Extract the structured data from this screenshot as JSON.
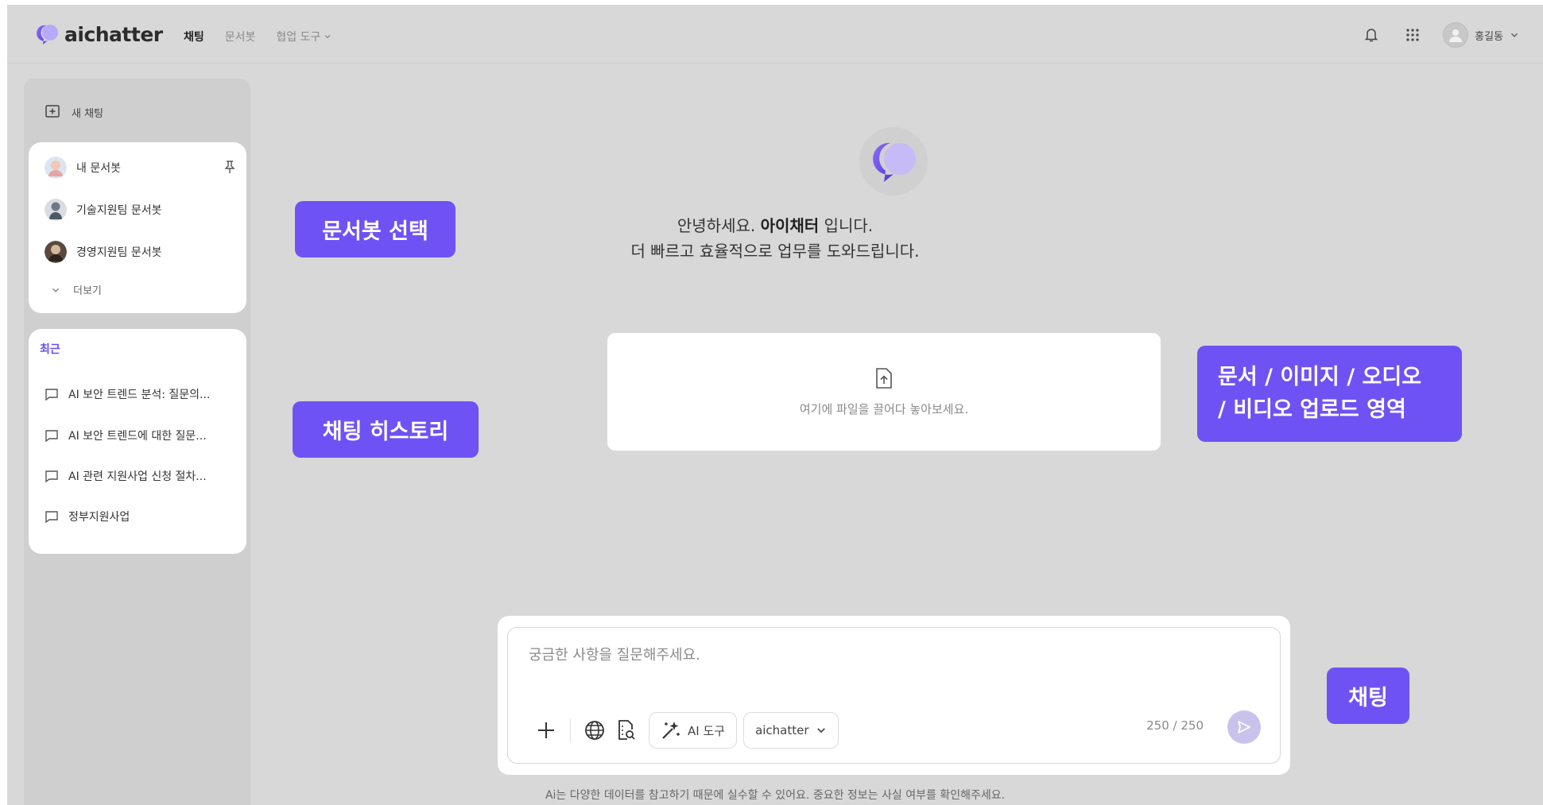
{
  "header": {
    "logo_text": "aichatter",
    "nav": {
      "chat": "채팅",
      "docbot": "문서봇",
      "collab": "협업 도구"
    },
    "user_name": "홍길동"
  },
  "sidebar": {
    "new_chat": "새 채팅",
    "bots": [
      {
        "label": "내 문서봇"
      },
      {
        "label": "기술지원팀 문서봇"
      },
      {
        "label": "경영지원팀 문서봇"
      }
    ],
    "more": "더보기",
    "recent_title": "최근",
    "recent": [
      {
        "label": "AI 보안 트렌드 분석: 질문의..."
      },
      {
        "label": "AI 보안 트렌드에 대한 질문..."
      },
      {
        "label": "AI 관련 지원사업 신청 절차..."
      },
      {
        "label": "정부지원사업"
      }
    ]
  },
  "main": {
    "greet_pre": "안녕하세요. ",
    "greet_bold": "아이채터",
    "greet_post": " 입니다.",
    "greet_line2": "더 빠르고 효율적으로 업무를 도와드립니다.",
    "drop_text": "여기에 파일을 끌어다 놓아보세요."
  },
  "chat": {
    "placeholder": "궁금한 사항을 질문해주세요.",
    "ai_tool": "AI 도구",
    "model": "aichatter",
    "count": "250 / 250",
    "disclaimer": "Ai는 다양한 데이터를 참고하기 때문에 실수할 수 있어요. 중요한 정보는 사실 여부를 확인해주세요."
  },
  "annotations": {
    "docbot_select": "문서봇 선택",
    "chat_history": "채팅 히스토리",
    "upload_line1": "문서 / 이미지 / 오디오",
    "upload_line2": "/ 비디오 업로드 영역",
    "chat": "채팅"
  },
  "colors": {
    "accent": "#6f52f4",
    "background": "#d8d8d8"
  }
}
